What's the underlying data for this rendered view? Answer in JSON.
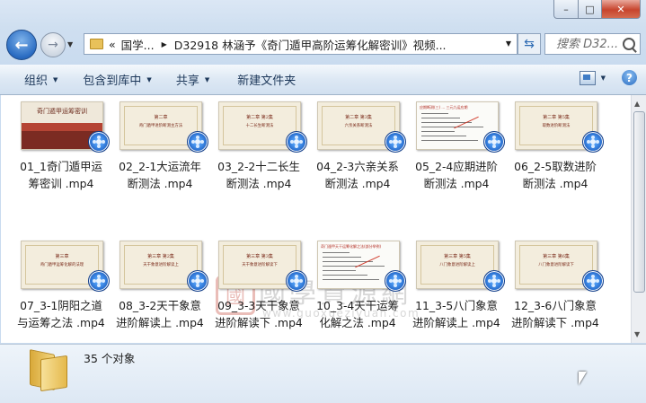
{
  "window": {
    "caption_buttons": {
      "minimize": "–",
      "maximize": "□",
      "close": "✕"
    }
  },
  "nav": {
    "back_icon": "←",
    "forward_icon": "→",
    "address_segments": [
      "«",
      "国学...",
      "D32918  林涵予《奇门遁甲高阶运筹化解密训》视频..."
    ],
    "search_placeholder": "搜索 D32..."
  },
  "toolbar": {
    "organize": "组织",
    "include_in_library": "包含到库中",
    "share": "共享",
    "new_folder": "新建文件夹"
  },
  "files": [
    {
      "name": "01_1奇门遁甲运筹密训 .mp4",
      "line1": "01_1奇门遁甲运",
      "line2": "筹密训 .mp4",
      "thumb_type": "temple",
      "thumb_title": "奇门遁甲运筹密训"
    },
    {
      "name": "02_2-1大运流年断测法 .mp4",
      "line1": "02_2-1大运流年",
      "line2": "断测法 .mp4",
      "thumb_type": "slide",
      "thumb_ch": "第二章",
      "thumb_sub": "奇门遁甲进阶断测主方法"
    },
    {
      "name": "03_2-2十二长生断测法 .mp4",
      "line1": "03_2-2十二长生",
      "line2": "断测法 .mp4",
      "thumb_type": "slide",
      "thumb_ch": "第二章  第2集",
      "thumb_sub": "十二长生断测法"
    },
    {
      "name": "04_2-3六亲关系断测法 .mp4",
      "line1": "04_2-3六亲关系",
      "line2": "断测法 .mp4",
      "thumb_type": "slide",
      "thumb_ch": "第二章  第3集",
      "thumb_sub": "六亲关系断测法"
    },
    {
      "name": "05_2-4应期进阶断测法 .mp4",
      "line1": "05_2-4应期进阶",
      "line2": "断测法 .mp4",
      "thumb_type": "doc",
      "thumb_head": "应期断测(三) ... 三元九运应期"
    },
    {
      "name": "06_2-5取数进阶断测法 .mp4",
      "line1": "06_2-5取数进阶",
      "line2": "断测法 .mp4",
      "thumb_type": "slide",
      "thumb_ch": "第二章  第5集",
      "thumb_sub": "取数进阶断测法"
    },
    {
      "name": "07_3-1阴阳之道与运筹之法 .mp4",
      "line1": "07_3-1阴阳之道",
      "line2": "与运筹之法 .mp4",
      "thumb_type": "slide",
      "thumb_ch": "第三章",
      "thumb_sub": "奇门遁甲运筹化解的法理"
    },
    {
      "name": "08_3-2天干象意进阶解读上 .mp4",
      "line1": "08_3-2天干象意",
      "line2": "进阶解读上 .mp4",
      "thumb_type": "slide",
      "thumb_ch": "第三章  第2集",
      "thumb_sub": "天干象意进阶解读上"
    },
    {
      "name": "09_3-3天干象意进阶解读下 .mp4",
      "line1": "09_3-3天干象意",
      "line2": "进阶解读下 .mp4",
      "thumb_type": "slide",
      "thumb_ch": "第三章  第3集",
      "thumb_sub": "天干象意进阶解读下"
    },
    {
      "name": "10_3-4天干运筹化解之法 .mp4",
      "line1": "10_3-4天干运筹",
      "line2": "化解之法 .mp4",
      "thumb_type": "doc",
      "thumb_head": "奇门遁甲天干运筹化解之法(部分举例)"
    },
    {
      "name": "11_3-5八门象意进阶解读上 .mp4",
      "line1": "11_3-5八门象意",
      "line2": "进阶解读上 .mp4",
      "thumb_type": "slide",
      "thumb_ch": "第三章  第5集",
      "thumb_sub": "八门象意进阶解读上"
    },
    {
      "name": "12_3-6八门象意进阶解读下 .mp4",
      "line1": "12_3-6八门象意",
      "line2": "进阶解读下 .mp4",
      "thumb_type": "slide",
      "thumb_ch": "第三章  第6集",
      "thumb_sub": "八门象意进阶解读下"
    }
  ],
  "watermark": {
    "seal": "國",
    "text": "國學資源網",
    "url": "www.guoxueziyuan.com"
  },
  "details": {
    "item_count": "35 个对象"
  },
  "colors": {
    "accent": "#1e395b",
    "play_icon": "#1d5ec0",
    "window_bg": "#cfdff0"
  }
}
